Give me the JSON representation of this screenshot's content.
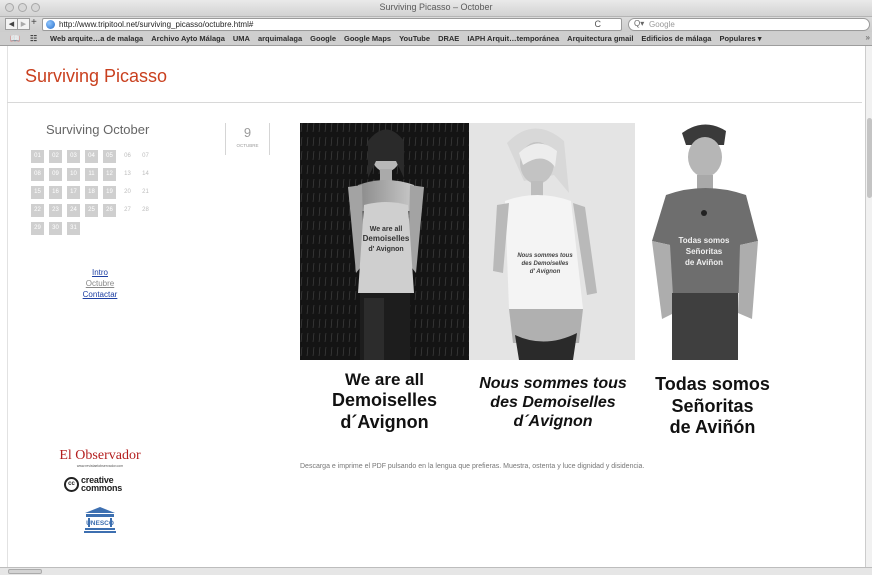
{
  "window": {
    "title": "Surviving Picasso – October"
  },
  "toolbar": {
    "back": "◀",
    "forward": "▶",
    "add": "+",
    "url": "http://www.tripitool.net/surviving_picasso/octubre.html#",
    "reload": "C",
    "search_placeholder": "Google",
    "search_icon": "Q▾"
  },
  "bookmarks": {
    "items": [
      "Web arquite…a de malaga",
      "Archivo Ayto Málaga",
      "UMA",
      "arquimalaga",
      "Google",
      "Google Maps",
      "YouTube",
      "DRAE",
      "IAPH Arquit…temporánea",
      "Arquitectura gmail",
      "Edificios de málaga",
      "Populares ▾"
    ],
    "more": "»"
  },
  "site": {
    "title": "Surviving Picasso"
  },
  "calendar": {
    "title": "Surviving October",
    "days": [
      "01",
      "02",
      "03",
      "04",
      "05",
      "06",
      "07",
      "08",
      "09",
      "10",
      "11",
      "12",
      "13",
      "14",
      "15",
      "16",
      "17",
      "18",
      "19",
      "20",
      "21",
      "22",
      "23",
      "24",
      "25",
      "26",
      "27",
      "28",
      "29",
      "30",
      "31"
    ],
    "active_days": [
      "01",
      "02",
      "03",
      "04",
      "05",
      "08",
      "09",
      "10",
      "11",
      "12",
      "15",
      "16",
      "17",
      "18",
      "19",
      "22",
      "23",
      "24",
      "25",
      "26",
      "29",
      "30",
      "31"
    ]
  },
  "date": {
    "day": "9",
    "month": "OCTUBRE"
  },
  "nav": {
    "intro": "Intro",
    "octubre": "Octubre",
    "contactar": "Contactar"
  },
  "logos": {
    "observador": "El Observador",
    "observador_sub": "www.revistaelobservador.com",
    "cc_mark": "cc",
    "cc_line1": "creative",
    "cc_line2": "commons",
    "unesco": "UNESCO"
  },
  "panels": [
    {
      "shirt_l1": "We are all",
      "shirt_l2": "Demoiselles",
      "shirt_l3": "d' Avignon",
      "caption_l1": "We are all",
      "caption_l2": "Demoiselles",
      "caption_l3": "d´Avignon"
    },
    {
      "shirt_l1": "Nous sommes tous",
      "shirt_l2": "des Demoiselles",
      "shirt_l3": "d' Avignon",
      "caption_l1": "Nous sommes tous",
      "caption_l2": "des Demoiselles",
      "caption_l3": "d´Avignon"
    },
    {
      "shirt_l1": "Todas somos",
      "shirt_l2": "Señoritas",
      "shirt_l3": "de Aviñon",
      "caption_l1": "Todas somos",
      "caption_l2": "Señoritas",
      "caption_l3": "de Aviñón"
    }
  ],
  "description": "Descarga e imprime el PDF pulsando en la lengua que prefieras. Muestra, ostenta y luce dignidad y disidencia."
}
